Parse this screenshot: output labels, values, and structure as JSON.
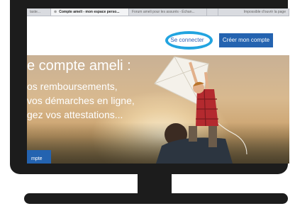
{
  "browser": {
    "tabs": [
      {
        "label": "taste...",
        "active": false
      },
      {
        "label": "Compte ameli - mon espace perso...",
        "active": true
      },
      {
        "label": "Forum ameli pour les assurés - Échan...",
        "active": false
      },
      {
        "label": "",
        "active": false
      },
      {
        "label": "Impossible d'ouvrir la page",
        "active": false
      }
    ],
    "close_glyph": "⊗"
  },
  "header": {
    "login_label": "Se connecter",
    "create_label": "Créer mon compte",
    "highlight_color": "#22a4e0",
    "brand_color": "#2463b0"
  },
  "hero": {
    "title": "e compte ameli :",
    "lines": [
      "os remboursements,",
      " vos démarches en ligne,",
      "gez vos attestations..."
    ],
    "cta_label": "mpte"
  }
}
